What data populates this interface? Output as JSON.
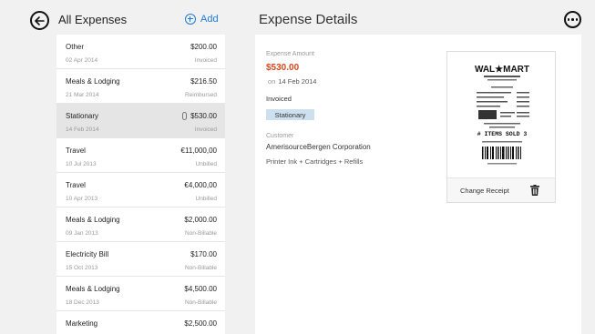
{
  "list_header": {
    "title": "All Expenses",
    "add_label": "Add"
  },
  "expenses": [
    {
      "name": "Other",
      "amount": "$200.00",
      "date": "02 Apr 2014",
      "status": "Invoiced"
    },
    {
      "name": "Meals & Lodging",
      "amount": "$216.50",
      "date": "21 Mar 2014",
      "status": "Reimbursed"
    },
    {
      "name": "Stationary",
      "amount": "$530.00",
      "date": "14 Feb 2014",
      "status": "Invoiced"
    },
    {
      "name": "Travel",
      "amount": "€11,000,00",
      "date": "10 Jul 2013",
      "status": "Unbilled"
    },
    {
      "name": "Travel",
      "amount": "€4,000,00",
      "date": "10 Apr 2013",
      "status": "Unbilled"
    },
    {
      "name": "Meals & Lodging",
      "amount": "$2,000.00",
      "date": "09 Jan 2013",
      "status": "Non-Billable"
    },
    {
      "name": "Electricity Bill",
      "amount": "$170.00",
      "date": "15 Oct 2013",
      "status": "Non-Billable"
    },
    {
      "name": "Meals & Lodging",
      "amount": "$4,500.00",
      "date": "18 Dec 2013",
      "status": "Non-Billable"
    },
    {
      "name": "Marketing",
      "amount": "$2,500.00",
      "date": "",
      "status": ""
    }
  ],
  "selected_index": 2,
  "details": {
    "title": "Expense Details",
    "amount_label": "Expense Amount",
    "amount": "$530.00",
    "date_prefix": "on",
    "date": "14 Feb 2014",
    "status": "Invoiced",
    "category": "Stationary",
    "customer_label": "Customer",
    "customer": "AmerisourceBergen Corporation",
    "notes": "Printer Ink + Cartridges + Refills"
  },
  "receipt": {
    "store_logo_text": "WAL★MART",
    "summary_text": "# ITEMS SOLD 3",
    "change_label": "Change Receipt"
  },
  "colors": {
    "accent": "#1e7bd6",
    "amount": "#d9461e",
    "category_tag": "#cde0ef",
    "selected_row": "#e5e5e5"
  }
}
